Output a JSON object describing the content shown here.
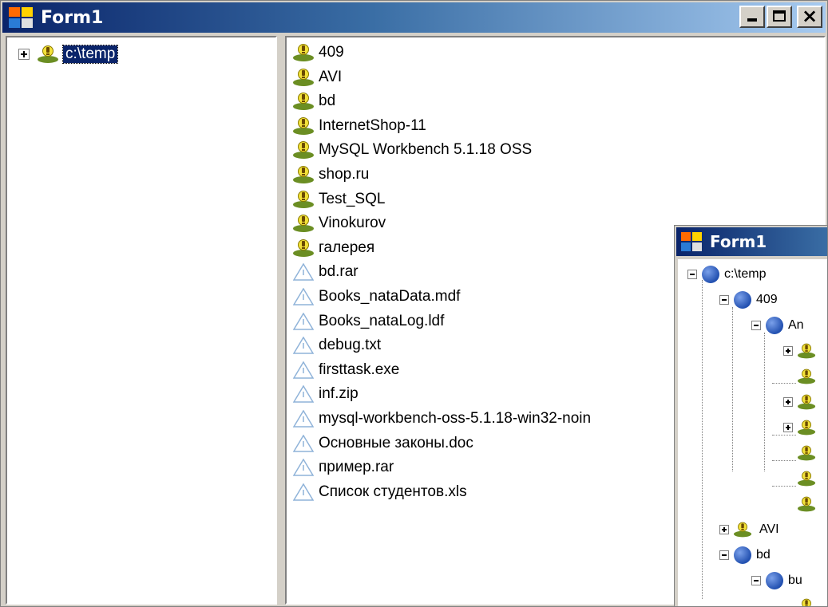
{
  "main_window": {
    "title": "Form1",
    "tree": {
      "root_label": "c:\\temp"
    },
    "file_list": [
      {
        "name": "409",
        "kind": "folder"
      },
      {
        "name": "AVI",
        "kind": "folder"
      },
      {
        "name": "bd",
        "kind": "folder"
      },
      {
        "name": "InternetShop-11",
        "kind": "folder"
      },
      {
        "name": "MySQL Workbench 5.1.18 OSS",
        "kind": "folder"
      },
      {
        "name": "shop.ru",
        "kind": "folder"
      },
      {
        "name": "Test_SQL",
        "kind": "folder"
      },
      {
        "name": "Vinokurov",
        "kind": "folder"
      },
      {
        "name": "галерея",
        "kind": "folder"
      },
      {
        "name": "bd.rar",
        "kind": "file"
      },
      {
        "name": "Books_nataData.mdf",
        "kind": "file"
      },
      {
        "name": "Books_nataLog.ldf",
        "kind": "file"
      },
      {
        "name": "debug.txt",
        "kind": "file"
      },
      {
        "name": "firsttask.exe",
        "kind": "file"
      },
      {
        "name": "inf.zip",
        "kind": "file"
      },
      {
        "name": "mysql-workbench-oss-5.1.18-win32-noin",
        "kind": "file"
      },
      {
        "name": "Основные законы.doc",
        "kind": "file"
      },
      {
        "name": "пример.rar",
        "kind": "file"
      },
      {
        "name": "Список студентов.xls",
        "kind": "file"
      }
    ]
  },
  "inset_window": {
    "title": "Form1",
    "nodes": {
      "root": "c:\\temp",
      "n409": "409",
      "n409_child": "An",
      "avi": "AVI",
      "bd": "bd",
      "bd_child": "bu"
    }
  },
  "icons": {
    "folder": "smiley-folder-icon",
    "file": "warning-triangle-icon",
    "app": "form-app-icon",
    "node": "blue-sphere-icon"
  },
  "colors": {
    "title_gradient_start": "#0a246a",
    "title_gradient_end": "#a6caf0",
    "selection": "#0a246a",
    "window_face": "#d4d0c8"
  }
}
